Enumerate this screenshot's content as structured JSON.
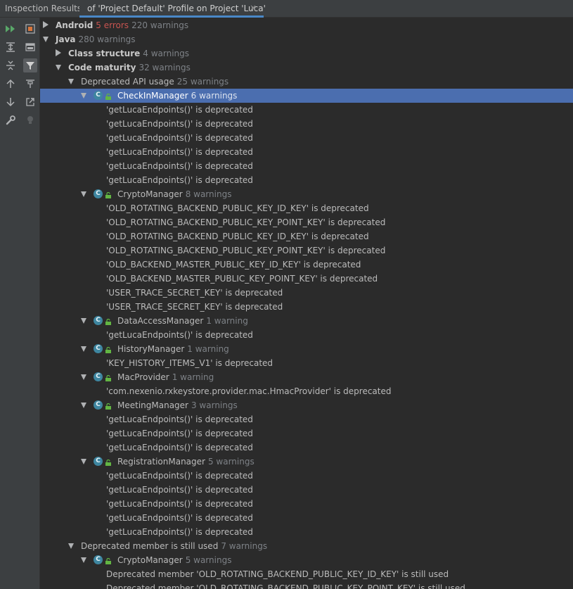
{
  "header": {
    "title": "Inspection Results:",
    "tab_label": "of 'Project Default' Profile on Project 'Luca'",
    "tab_close": "×"
  },
  "toolbar": {
    "buttons": [
      {
        "name": "rerun-icon",
        "col": 0
      },
      {
        "name": "stop-icon",
        "col": 1
      },
      {
        "name": "expand-all-icon",
        "col": 0
      },
      {
        "name": "group-by-icon",
        "col": 1
      },
      {
        "name": "collapse-all-icon",
        "col": 0
      },
      {
        "name": "filter-icon",
        "col": 1,
        "active": true
      },
      {
        "name": "previous-icon",
        "col": 0
      },
      {
        "name": "pin-icon",
        "col": 1
      },
      {
        "name": "next-icon",
        "col": 0
      },
      {
        "name": "export-icon",
        "col": 1
      },
      {
        "name": "settings-wrench-icon",
        "col": 0
      },
      {
        "name": "lightbulb-icon",
        "col": 1
      }
    ]
  },
  "tree": [
    {
      "level": 0,
      "expanded": false,
      "kind": "group",
      "label": "Android",
      "errors": "5 errors",
      "count": "220 warnings"
    },
    {
      "level": 0,
      "expanded": true,
      "kind": "group",
      "label": "Java",
      "count": "280 warnings"
    },
    {
      "level": 1,
      "expanded": false,
      "kind": "group",
      "label": "Class structure",
      "count": "4 warnings"
    },
    {
      "level": 1,
      "expanded": true,
      "kind": "group",
      "label": "Code maturity",
      "count": "32 warnings"
    },
    {
      "level": 2,
      "expanded": true,
      "kind": "inspection",
      "label": "Deprecated API usage",
      "count": "25 warnings"
    },
    {
      "level": 3,
      "expanded": true,
      "kind": "class",
      "label": "CheckInManager",
      "count": "6 warnings",
      "selected": true
    },
    {
      "level": 4,
      "kind": "problem",
      "label": "'getLucaEndpoints()' is deprecated"
    },
    {
      "level": 4,
      "kind": "problem",
      "label": "'getLucaEndpoints()' is deprecated"
    },
    {
      "level": 4,
      "kind": "problem",
      "label": "'getLucaEndpoints()' is deprecated"
    },
    {
      "level": 4,
      "kind": "problem",
      "label": "'getLucaEndpoints()' is deprecated"
    },
    {
      "level": 4,
      "kind": "problem",
      "label": "'getLucaEndpoints()' is deprecated"
    },
    {
      "level": 4,
      "kind": "problem",
      "label": "'getLucaEndpoints()' is deprecated"
    },
    {
      "level": 3,
      "expanded": true,
      "kind": "class",
      "label": "CryptoManager",
      "count": "8 warnings"
    },
    {
      "level": 4,
      "kind": "problem",
      "label": "'OLD_ROTATING_BACKEND_PUBLIC_KEY_ID_KEY' is deprecated"
    },
    {
      "level": 4,
      "kind": "problem",
      "label": "'OLD_ROTATING_BACKEND_PUBLIC_KEY_POINT_KEY' is deprecated"
    },
    {
      "level": 4,
      "kind": "problem",
      "label": "'OLD_ROTATING_BACKEND_PUBLIC_KEY_ID_KEY' is deprecated"
    },
    {
      "level": 4,
      "kind": "problem",
      "label": "'OLD_ROTATING_BACKEND_PUBLIC_KEY_POINT_KEY' is deprecated"
    },
    {
      "level": 4,
      "kind": "problem",
      "label": "'OLD_BACKEND_MASTER_PUBLIC_KEY_ID_KEY' is deprecated"
    },
    {
      "level": 4,
      "kind": "problem",
      "label": "'OLD_BACKEND_MASTER_PUBLIC_KEY_POINT_KEY' is deprecated"
    },
    {
      "level": 4,
      "kind": "problem",
      "label": "'USER_TRACE_SECRET_KEY' is deprecated"
    },
    {
      "level": 4,
      "kind": "problem",
      "label": "'USER_TRACE_SECRET_KEY' is deprecated"
    },
    {
      "level": 3,
      "expanded": true,
      "kind": "class",
      "label": "DataAccessManager",
      "count": "1 warning"
    },
    {
      "level": 4,
      "kind": "problem",
      "label": "'getLucaEndpoints()' is deprecated"
    },
    {
      "level": 3,
      "expanded": true,
      "kind": "class",
      "label": "HistoryManager",
      "count": "1 warning"
    },
    {
      "level": 4,
      "kind": "problem",
      "label": "'KEY_HISTORY_ITEMS_V1' is deprecated"
    },
    {
      "level": 3,
      "expanded": true,
      "kind": "class",
      "label": "MacProvider",
      "count": "1 warning"
    },
    {
      "level": 4,
      "kind": "problem",
      "label": "'com.nexenio.rxkeystore.provider.mac.HmacProvider' is deprecated"
    },
    {
      "level": 3,
      "expanded": true,
      "kind": "class",
      "label": "MeetingManager",
      "count": "3 warnings"
    },
    {
      "level": 4,
      "kind": "problem",
      "label": "'getLucaEndpoints()' is deprecated"
    },
    {
      "level": 4,
      "kind": "problem",
      "label": "'getLucaEndpoints()' is deprecated"
    },
    {
      "level": 4,
      "kind": "problem",
      "label": "'getLucaEndpoints()' is deprecated"
    },
    {
      "level": 3,
      "expanded": true,
      "kind": "class",
      "label": "RegistrationManager",
      "count": "5 warnings"
    },
    {
      "level": 4,
      "kind": "problem",
      "label": "'getLucaEndpoints()' is deprecated"
    },
    {
      "level": 4,
      "kind": "problem",
      "label": "'getLucaEndpoints()' is deprecated"
    },
    {
      "level": 4,
      "kind": "problem",
      "label": "'getLucaEndpoints()' is deprecated"
    },
    {
      "level": 4,
      "kind": "problem",
      "label": "'getLucaEndpoints()' is deprecated"
    },
    {
      "level": 4,
      "kind": "problem",
      "label": "'getLucaEndpoints()' is deprecated"
    },
    {
      "level": 2,
      "expanded": true,
      "kind": "inspection",
      "label": "Deprecated member is still used",
      "count": "7 warnings"
    },
    {
      "level": 3,
      "expanded": true,
      "kind": "class",
      "label": "CryptoManager",
      "count": "5 warnings"
    },
    {
      "level": 4,
      "kind": "problem",
      "label": "Deprecated member 'OLD_ROTATING_BACKEND_PUBLIC_KEY_ID_KEY' is still used"
    },
    {
      "level": 4,
      "kind": "problem",
      "label": "Deprecated member 'OLD_ROTATING_BACKEND_PUBLIC_KEY_POINT_KEY' is still used"
    }
  ],
  "colors": {
    "background": "#2b2b2b",
    "panel": "#3c3f41",
    "selection": "#4b6eaf",
    "error": "#c75450",
    "muted": "#7e8287",
    "class_icon": "#3e86a0"
  }
}
